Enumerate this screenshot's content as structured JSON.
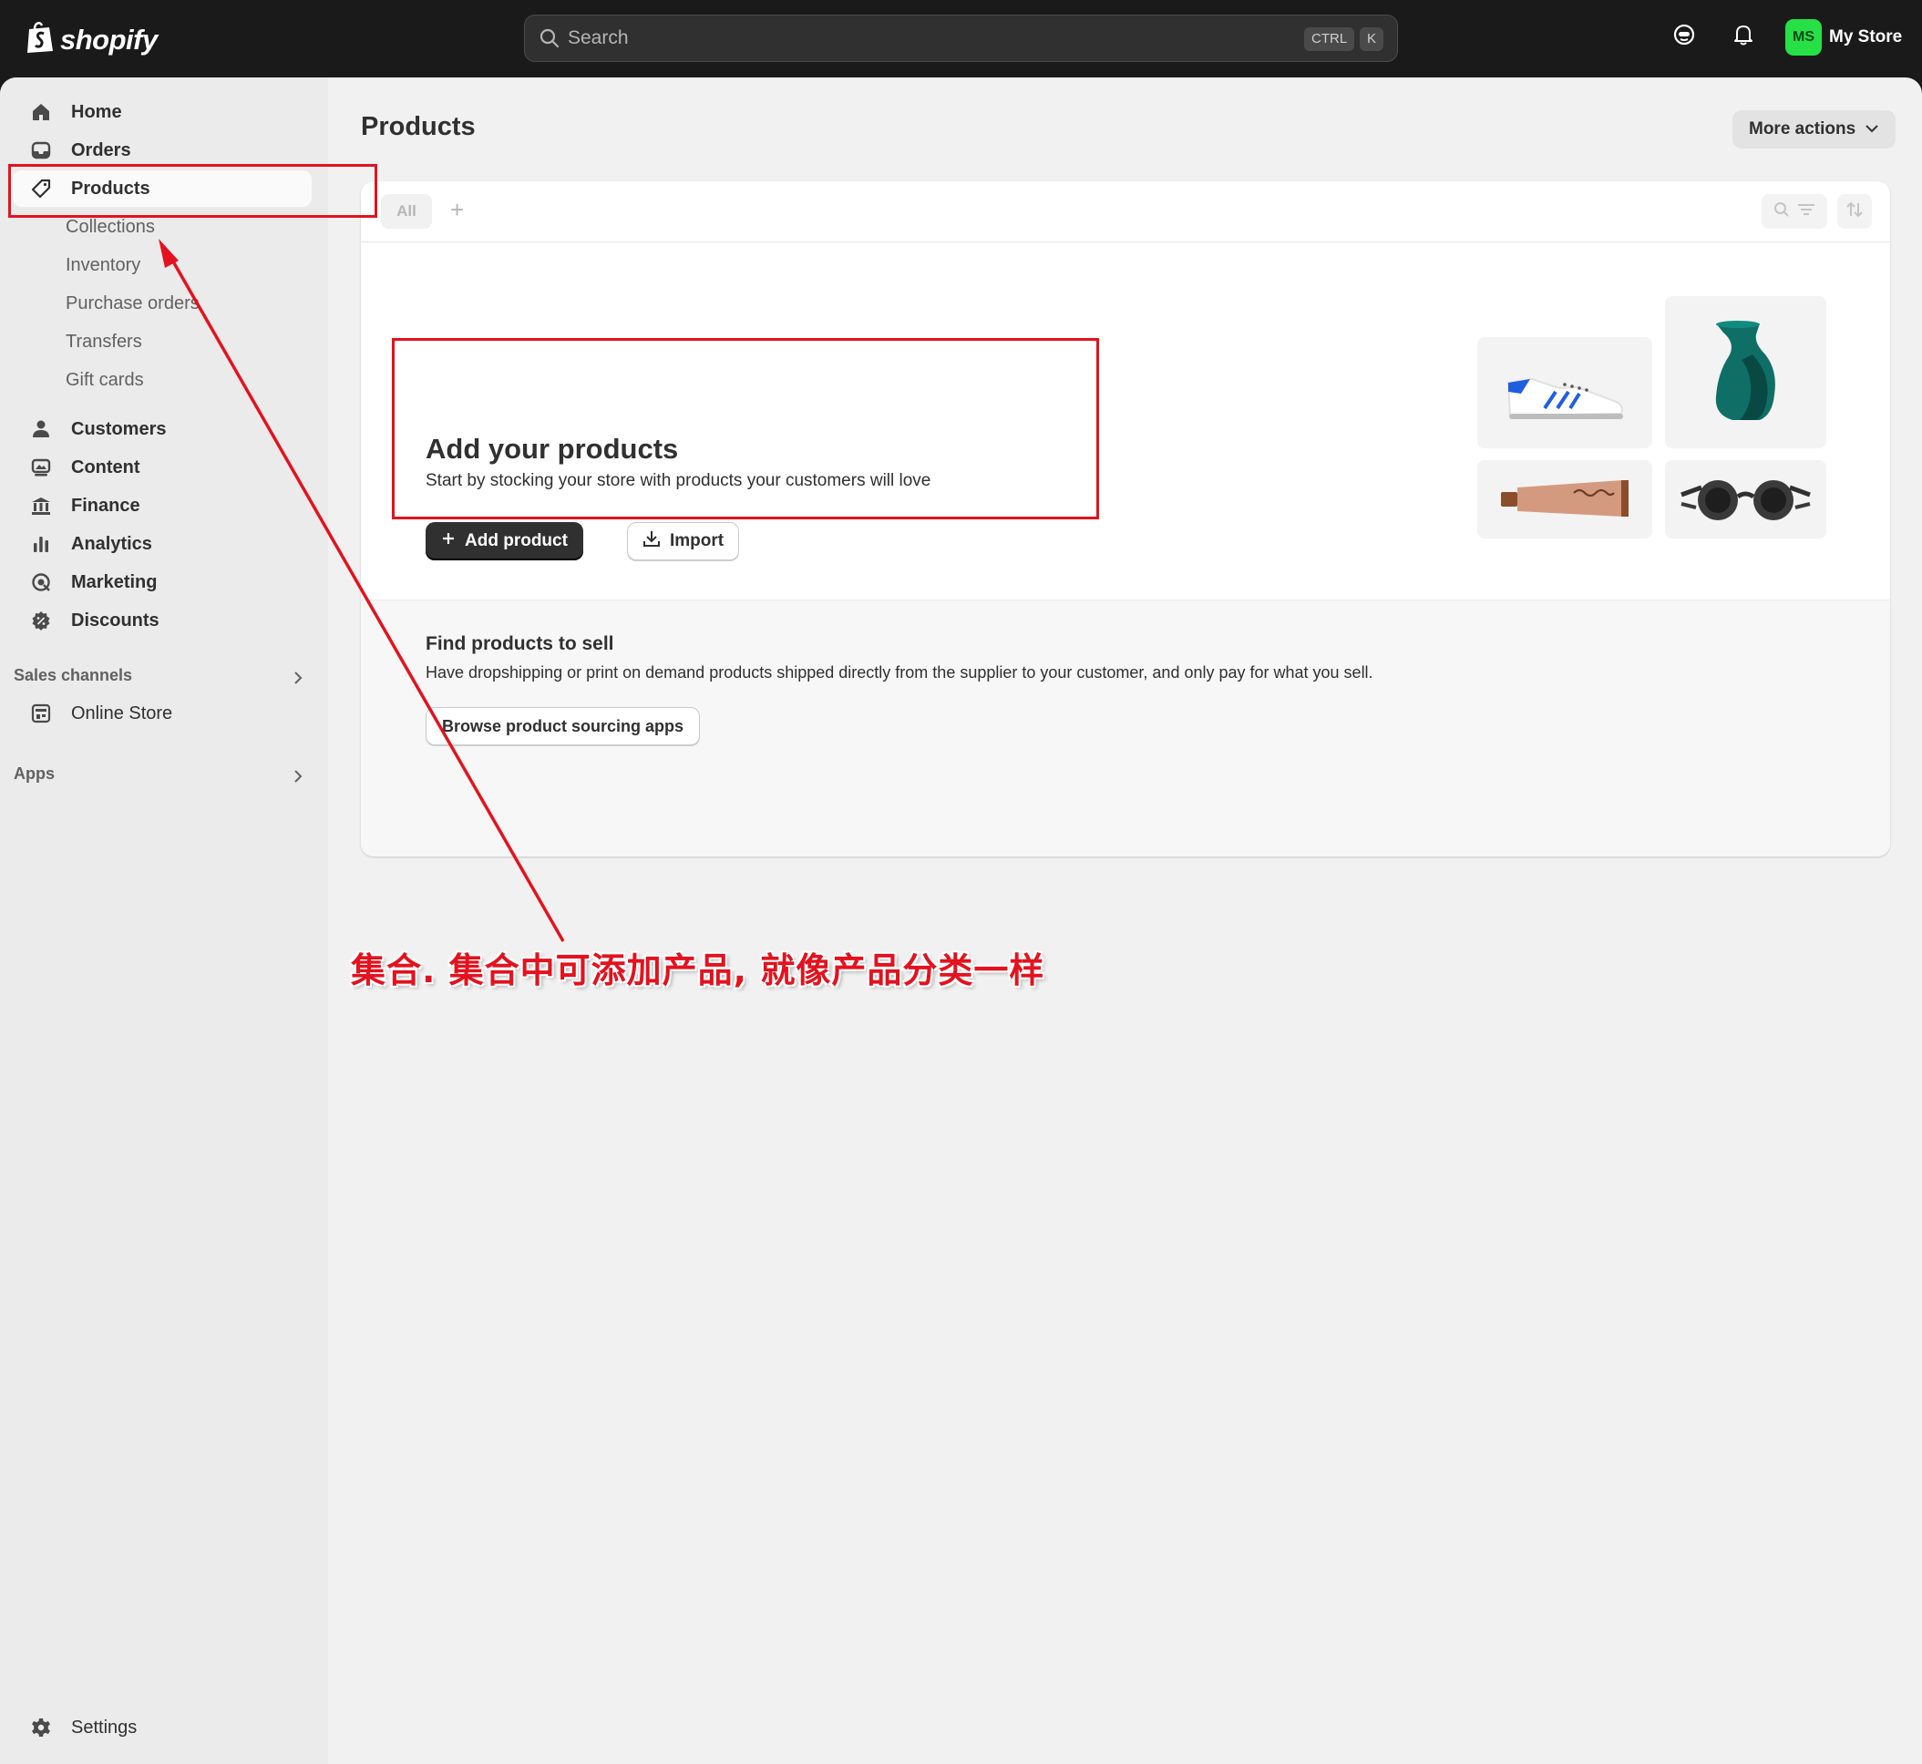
{
  "topbar": {
    "logo_text": "shopify",
    "search_placeholder": "Search",
    "shortcut_ctrl": "CTRL",
    "shortcut_k": "K",
    "avatar_initials": "MS",
    "store_name": "My Store",
    "avatar_color": "#25e146"
  },
  "sidebar": {
    "items": [
      {
        "label": "Home",
        "icon": "home-icon"
      },
      {
        "label": "Orders",
        "icon": "inbox-icon"
      },
      {
        "label": "Products",
        "icon": "tag-icon"
      },
      {
        "label": "Customers",
        "icon": "person-icon"
      },
      {
        "label": "Content",
        "icon": "image-icon"
      },
      {
        "label": "Finance",
        "icon": "bank-icon"
      },
      {
        "label": "Analytics",
        "icon": "bar-chart-icon"
      },
      {
        "label": "Marketing",
        "icon": "target-icon"
      },
      {
        "label": "Discounts",
        "icon": "discount-icon"
      }
    ],
    "product_subitems": [
      "Collections",
      "Inventory",
      "Purchase orders",
      "Transfers",
      "Gift cards"
    ],
    "sales_channels_heading": "Sales channels",
    "online_store_label": "Online Store",
    "apps_heading": "Apps",
    "settings_label": "Settings"
  },
  "main": {
    "page_title": "Products",
    "more_actions_label": "More actions",
    "tabs": {
      "all_label": "All",
      "add_symbol": "+"
    },
    "empty_state": {
      "title": "Add your products",
      "description": "Start by stocking your store with products your customers will love",
      "add_product_label": "Add product",
      "import_label": "Import"
    },
    "find_products": {
      "title": "Find products to sell",
      "description": "Have dropshipping or print on demand products shipped directly from the supplier to your customer, and only pay for what you sell.",
      "button_label": "Browse product sourcing apps"
    }
  },
  "annotation": {
    "text": "集合. 集合中可添加产品, 就像产品分类一样",
    "color": "#e3121e"
  }
}
